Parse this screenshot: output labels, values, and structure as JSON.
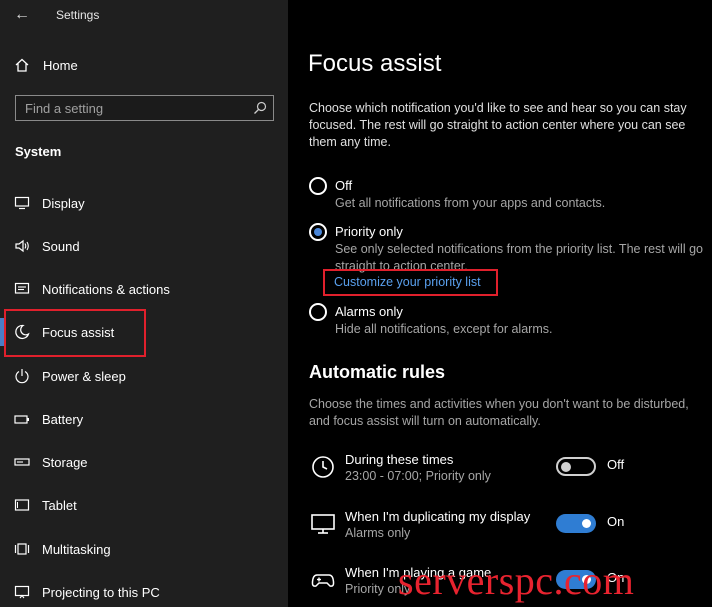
{
  "window": {
    "title": "Settings"
  },
  "sidebar": {
    "home_label": "Home",
    "search_placeholder": "Find a setting",
    "section_title": "System",
    "items": [
      {
        "label": "Display",
        "icon": "monitor-icon"
      },
      {
        "label": "Sound",
        "icon": "speaker-icon"
      },
      {
        "label": "Notifications & actions",
        "icon": "notification-icon"
      },
      {
        "label": "Focus assist",
        "icon": "moon-icon",
        "selected": true
      },
      {
        "label": "Power & sleep",
        "icon": "power-icon"
      },
      {
        "label": "Battery",
        "icon": "battery-icon"
      },
      {
        "label": "Storage",
        "icon": "storage-icon"
      },
      {
        "label": "Tablet",
        "icon": "tablet-icon"
      },
      {
        "label": "Multitasking",
        "icon": "multitasking-icon"
      },
      {
        "label": "Projecting to this PC",
        "icon": "projecting-icon"
      }
    ]
  },
  "main": {
    "title": "Focus assist",
    "description": "Choose which notification you'd like to see and hear so you can stay focused. The rest will go straight to action center where you can see them any time.",
    "options": [
      {
        "label": "Off",
        "description": "Get all notifications from your apps and contacts.",
        "checked": false
      },
      {
        "label": "Priority only",
        "description": "See only selected notifications from the priority list. The rest will go straight to action center.",
        "checked": true
      },
      {
        "label": "Alarms only",
        "description": "Hide all notifications, except for alarms.",
        "checked": false
      }
    ],
    "customize_link": "Customize your priority list",
    "automatic_rules": {
      "title": "Automatic rules",
      "description": "Choose the times and activities when you don't want to be disturbed, and focus assist will turn on automatically.",
      "rules": [
        {
          "label": "During these times",
          "sub": "23:00 - 07:00; Priority only",
          "state": "Off",
          "on": false,
          "icon": "clock-icon"
        },
        {
          "label": "When I'm duplicating my display",
          "sub": "Alarms only",
          "state": "On",
          "on": true,
          "icon": "display-icon"
        },
        {
          "label": "When I'm playing a game",
          "sub": "Priority only",
          "state": "On",
          "on": true,
          "icon": "gamepad-icon"
        }
      ]
    }
  },
  "watermark": "serverspc.com",
  "colors": {
    "accent": "#2f7dd3",
    "highlight_box": "#e0202c",
    "link": "#5aa0ee"
  }
}
